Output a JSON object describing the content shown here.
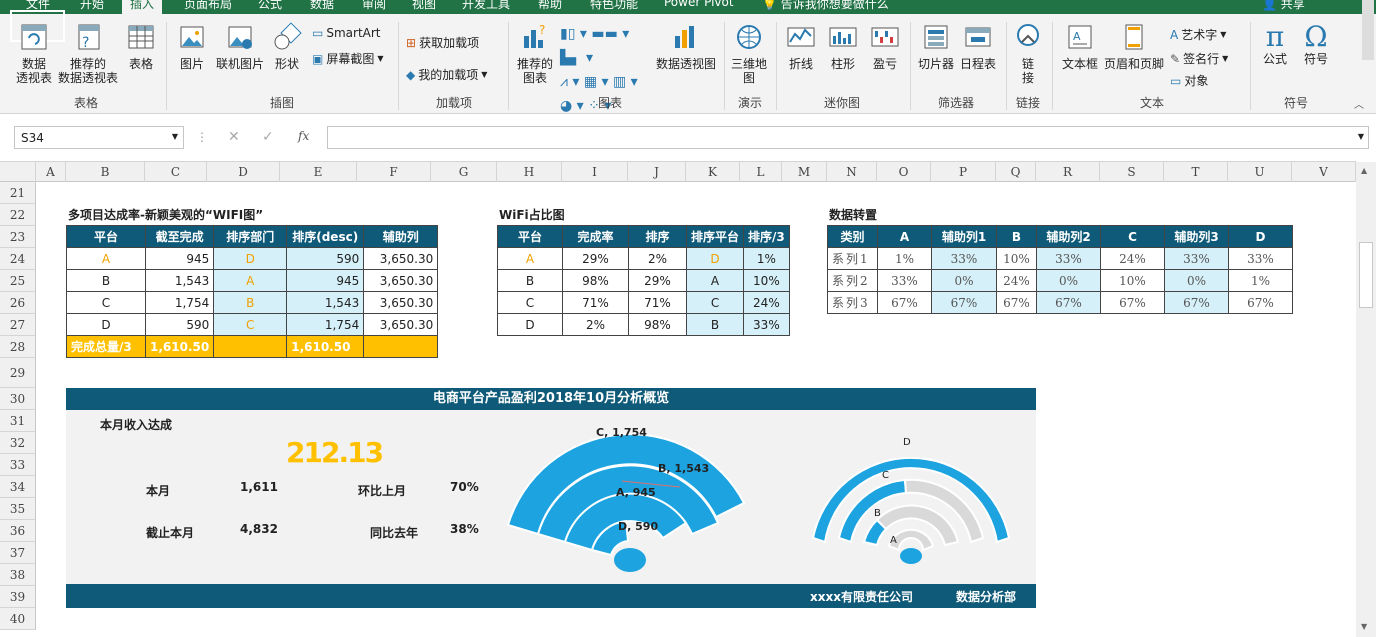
{
  "tabs": [
    "文件",
    "开始",
    "插入",
    "页面布局",
    "公式",
    "数据",
    "审阅",
    "视图",
    "开发工具",
    "帮助",
    "特色功能",
    "Power Pivot"
  ],
  "active_tab": "插入",
  "tell_me": "告诉我你想要做什么",
  "share": "共享",
  "ribbon": {
    "pivot": "数据\n透视表",
    "rec_pivot": "推荐的\n数据透视表",
    "table": "表格",
    "group_table": "表格",
    "picture": "图片",
    "online_picture": "联机图片",
    "shapes": "形状",
    "smartart": "SmartArt",
    "screenshot": "屏幕截图",
    "group_illus": "插图",
    "get_addins": "获取加载项",
    "my_addins": "我的加载项",
    "group_addins": "加载项",
    "rec_charts": "推荐的\n图表",
    "pivot_chart": "数据透视图",
    "group_charts": "图表",
    "map3d": "三维地\n图",
    "group_tour": "演示",
    "line": "折线",
    "column": "柱形",
    "winloss": "盈亏",
    "group_spark": "迷你图",
    "slicer": "切片器",
    "timeline": "日程表",
    "group_filter": "筛选器",
    "link": "链\n接",
    "group_link": "链接",
    "textbox": "文本框",
    "header_footer": "页眉和页脚",
    "wordart": "艺术字",
    "signature": "签名行",
    "object": "对象",
    "group_text": "文本",
    "equation": "公式",
    "symbol": "符号",
    "group_symbol": "符号"
  },
  "namebox": "S34",
  "fx": "fx",
  "columns": [
    "A",
    "B",
    "C",
    "D",
    "E",
    "F",
    "G",
    "H",
    "I",
    "J",
    "K",
    "L",
    "M",
    "N",
    "O",
    "P",
    "Q",
    "R",
    "S",
    "T",
    "U",
    "V"
  ],
  "rows": [
    "21",
    "22",
    "23",
    "24",
    "25",
    "26",
    "27",
    "28",
    "29",
    "30",
    "31",
    "32",
    "33",
    "34",
    "35",
    "36",
    "37",
    "38",
    "39",
    "40"
  ],
  "t1": {
    "title": "多项目达成率-新颖美观的“WIFI图”",
    "headers": [
      "平台",
      "截至完成",
      "排序部门",
      "排序(desc)",
      "辅助列"
    ],
    "rows": [
      [
        "A",
        "945",
        "D",
        "590",
        "3,650.30"
      ],
      [
        "B",
        "1,543",
        "A",
        "945",
        "3,650.30"
      ],
      [
        "C",
        "1,754",
        "B",
        "1,543",
        "3,650.30"
      ],
      [
        "D",
        "590",
        "C",
        "1,754",
        "3,650.30"
      ]
    ],
    "total": [
      "完成总量/3",
      "1,610.50",
      "",
      "1,610.50",
      ""
    ]
  },
  "t2": {
    "title": "WiFi占比图",
    "headers": [
      "平台",
      "完成率",
      "排序",
      "排序平台",
      "排序/3"
    ],
    "rows": [
      [
        "A",
        "29%",
        "2%",
        "D",
        "1%"
      ],
      [
        "B",
        "98%",
        "29%",
        "A",
        "10%"
      ],
      [
        "C",
        "71%",
        "71%",
        "C",
        "24%"
      ],
      [
        "D",
        "2%",
        "98%",
        "B",
        "33%"
      ]
    ]
  },
  "t3": {
    "title": "数据转置",
    "headers": [
      "类别",
      "A",
      "辅助列1",
      "B",
      "辅助列2",
      "C",
      "辅助列3",
      "D"
    ],
    "rows": [
      [
        "系列1",
        "1%",
        "33%",
        "10%",
        "33%",
        "24%",
        "33%",
        "33%"
      ],
      [
        "系列2",
        "33%",
        "0%",
        "24%",
        "0%",
        "10%",
        "0%",
        "1%"
      ],
      [
        "系列3",
        "67%",
        "67%",
        "67%",
        "67%",
        "67%",
        "67%",
        "67%"
      ]
    ]
  },
  "dashboard": {
    "title": "电商平台产品盈利2018年10月分析概览",
    "income_label": "本月收入达成",
    "big_value": "212.13",
    "month_label": "本月",
    "month_value": "1,611",
    "mom_label": "环比上月",
    "mom_value": "70%",
    "ytd_label": "截止本月",
    "ytd_value": "4,832",
    "yoy_label": "同比去年",
    "yoy_value": "38%",
    "company": "xxxx有限责任公司",
    "dept": "数据分析部",
    "chart1_labels": [
      "C, 1,754",
      "B, 1,543",
      "A, 945",
      "D, 590"
    ],
    "chart2_labels": [
      "D",
      "C",
      "B",
      "A"
    ],
    "accent": "#1ca3e0"
  }
}
